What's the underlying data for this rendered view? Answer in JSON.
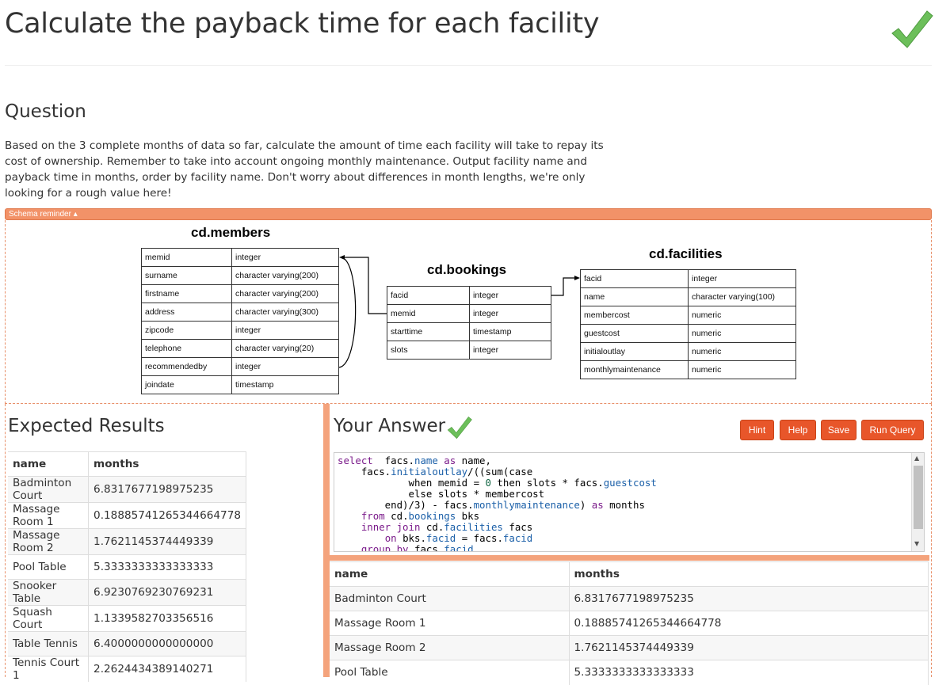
{
  "page": {
    "title": "Calculate the payback time for each facility"
  },
  "question": {
    "heading": "Question",
    "text": "Based on the 3 complete months of data so far, calculate the amount of time each facility will take to repay its cost of ownership. Remember to take into account ongoing monthly maintenance. Output facility name and payback time in months, order by facility name. Don't worry about differences in month lengths, we're only looking for a rough value here!"
  },
  "schema": {
    "toggle_label": "Schema reminder ▴",
    "members": {
      "title": "cd.members",
      "rows": [
        [
          "memid",
          "integer"
        ],
        [
          "surname",
          "character varying(200)"
        ],
        [
          "firstname",
          "character varying(200)"
        ],
        [
          "address",
          "character varying(300)"
        ],
        [
          "zipcode",
          "integer"
        ],
        [
          "telephone",
          "character varying(20)"
        ],
        [
          "recommendedby",
          "integer"
        ],
        [
          "joindate",
          "timestamp"
        ]
      ]
    },
    "bookings": {
      "title": "cd.bookings",
      "rows": [
        [
          "facid",
          "integer"
        ],
        [
          "memid",
          "integer"
        ],
        [
          "starttime",
          "timestamp"
        ],
        [
          "slots",
          "integer"
        ]
      ]
    },
    "facilities": {
      "title": "cd.facilities",
      "rows": [
        [
          "facid",
          "integer"
        ],
        [
          "name",
          "character varying(100)"
        ],
        [
          "membercost",
          "numeric"
        ],
        [
          "guestcost",
          "numeric"
        ],
        [
          "initialoutlay",
          "numeric"
        ],
        [
          "monthlymaintenance",
          "numeric"
        ]
      ]
    }
  },
  "expected": {
    "heading": "Expected Results",
    "columns": [
      "name",
      "months"
    ],
    "rows": [
      [
        "Badminton Court",
        "6.8317677198975235"
      ],
      [
        "Massage Room 1",
        "0.18885741265344664778"
      ],
      [
        "Massage Room 2",
        "1.7621145374449339"
      ],
      [
        "Pool Table",
        "5.3333333333333333"
      ],
      [
        "Snooker Table",
        "6.9230769230769231"
      ],
      [
        "Squash Court",
        "1.1339582703356516"
      ],
      [
        "Table Tennis",
        "6.4000000000000000"
      ],
      [
        "Tennis Court 1",
        "2.2624434389140271"
      ]
    ]
  },
  "answer": {
    "heading": "Your Answer",
    "buttons": {
      "hint": "Hint",
      "help": "Help",
      "save": "Save",
      "run": "Run Query"
    },
    "columns": [
      "name",
      "months"
    ],
    "rows": [
      [
        "Badminton Court",
        "6.8317677198975235"
      ],
      [
        "Massage Room 1",
        "0.18885741265344664778"
      ],
      [
        "Massage Room 2",
        "1.7621145374449339"
      ],
      [
        "Pool Table",
        "5.3333333333333333"
      ]
    ]
  },
  "colors": {
    "accent": "#e8562a",
    "schema_bar": "#f29268",
    "check": "#5cb85c"
  },
  "icons": {
    "title_check": "checkmark-icon",
    "answer_check": "checkmark-icon"
  }
}
